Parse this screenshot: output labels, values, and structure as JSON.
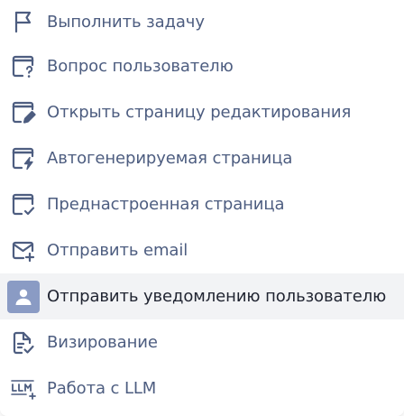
{
  "menu": {
    "items": [
      {
        "label": "Выполнить задачу",
        "icon": "flag-icon"
      },
      {
        "label": "Вопрос пользователю",
        "icon": "window-question-icon"
      },
      {
        "label": "Открыть страницу редактирования",
        "icon": "window-edit-icon"
      },
      {
        "label": "Автогенерируемая страница",
        "icon": "window-lightning-icon"
      },
      {
        "label": "Преднастроенная страница",
        "icon": "window-check-icon"
      },
      {
        "label": "Отправить email",
        "icon": "mail-plus-icon"
      },
      {
        "label": "Отправить уведомлению пользователю",
        "icon": "user-icon",
        "highlighted": true
      },
      {
        "label": "Визирование",
        "icon": "document-check-icon"
      },
      {
        "label": "Работа с LLM",
        "icon": "llm-icon"
      }
    ]
  },
  "colors": {
    "icon": "#4d5d80",
    "text": "#4d5d80",
    "highlight_bg": "#f2f3f5",
    "highlight_text": "#1f2330",
    "user_icon_bg": "#8a9bc4"
  }
}
